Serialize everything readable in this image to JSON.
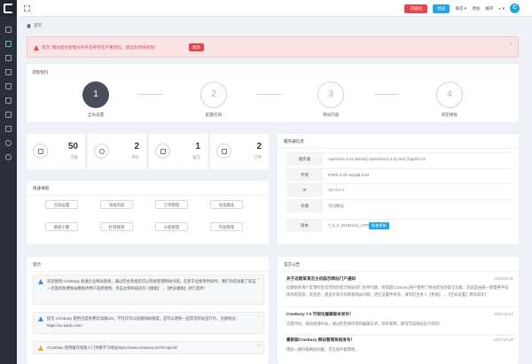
{
  "topbar": {
    "btn_red": "可视化",
    "btn_blue": "预览",
    "links": [
      "静态 ▾",
      "添加",
      "缓存",
      "◐ ▾"
    ],
    "avatar": "C"
  },
  "breadcrumb": "首页",
  "alert": {
    "text": "提示: 网站后台管理文件夹名称存在严重风险，建议你尽快修改！",
    "button": "修改",
    "close": "×"
  },
  "process": {
    "title": "流程指引",
    "steps": [
      {
        "num": "1",
        "label": "全局设置"
      },
      {
        "num": "2",
        "label": "配置栏目"
      },
      {
        "num": "3",
        "label": "添加内容"
      },
      {
        "num": "4",
        "label": "绑定模板"
      }
    ]
  },
  "stats": [
    {
      "num": "50",
      "label": "内容",
      "icon": "document-icon"
    },
    {
      "num": "2",
      "label": "评论",
      "icon": "chat-icon"
    },
    {
      "num": "1",
      "label": "留言",
      "icon": "mail-icon"
    },
    {
      "num": "2",
      "label": "订单",
      "icon": "cart-icon"
    }
  ],
  "quicknav": {
    "title": "快速导航",
    "buttons": [
      "全局设置",
      "添加内容",
      "订单管理",
      "生成静态",
      "模板引擎",
      "栏目管理",
      "分类管理",
      "内容管理"
    ]
  },
  "server": {
    "title": "服务器信息",
    "rows": [
      {
        "key": "服务器",
        "val": "Apache/2.4.23 (Win32) OpenSSL/1.0.2j mod_fcgid/2.3.9"
      },
      {
        "key": "环境",
        "val": "PHP5.3.29 mysql5.5.53"
      },
      {
        "key": "IP",
        "val": "127.0.0.1"
      },
      {
        "key": "存储",
        "val": "空间网址"
      },
      {
        "key": "版本",
        "val": "7_0_0_20181212_UTF8"
      }
    ],
    "update_btn": "检查更新"
  },
  "tips": {
    "title": "提示",
    "items": [
      "欢迎使用 CmsEasy 易通企业网站系统，通过后台系统您可以轻松管理网站内容。在新毕业使用时间时，我们为您准备了就这一百套的免费网站模板供用户选择使用，点击左侧导航栏的【模板】→【更多模板】进行选择！",
      "提示 CmsEasy 使用百度免费云加速cdn，不仅仅可以加速网站速度，还可以避免一些常见的攻击行为，注册地址：https://su.baidu.com/",
      "CmsEasy 使用操作快速入门手册学习地址https://www.cmseasy.cn/chm/quick/"
    ]
  },
  "news": {
    "title": "官方公告",
    "items": [
      {
        "title": "关于近期某某云主机临示网站门户通知",
        "date": "2019.03.31",
        "desc": "近期很多用户反馈阿里云控制台提示网站部门文件问题，原因是CmsEasy用户使用了网站后台的安全功能，因此是由某一款需要手动修改的选项，改变后，建议大家尽快修复网站问题，请在设置中修改，请到后台进入【系统】→【全局设置】修改成功！"
      },
      {
        "title": "CmsEasy 7.0 可视化编辑版本发布！",
        "date": "2018.12.12",
        "desc": "无需代码，拖动拖拽布局，通过所见即所得的编辑方式，简单易用，即可完成网站设计制作！"
      },
      {
        "title": "最新版CmsEasy 网站管理系统发布！",
        "date": "2017.09.18",
        "desc": "增加一键升级网站功能，可无损升级管理。"
      }
    ]
  }
}
